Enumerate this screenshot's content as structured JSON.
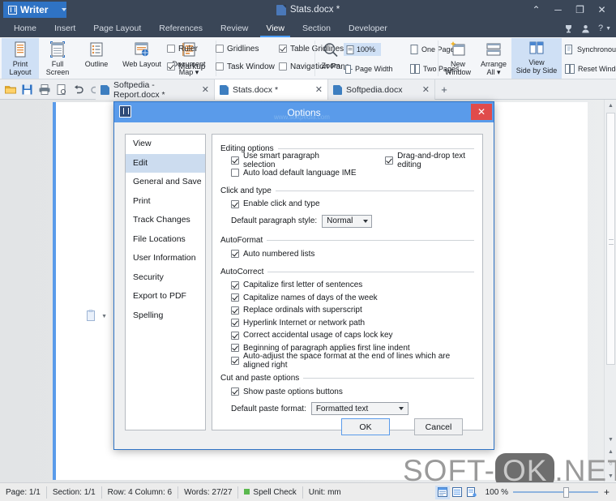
{
  "titlebar": {
    "app_name": "Writer",
    "document_title": "Stats.docx *",
    "controls": {
      "collapse": "⌃",
      "minimize": "─",
      "maximize": "❐",
      "close": "✕"
    }
  },
  "menu_tabs": [
    {
      "label": "Home",
      "active": false
    },
    {
      "label": "Insert",
      "active": false
    },
    {
      "label": "Page Layout",
      "active": false
    },
    {
      "label": "References",
      "active": false
    },
    {
      "label": "Review",
      "active": false
    },
    {
      "label": "View",
      "active": true
    },
    {
      "label": "Section",
      "active": false
    },
    {
      "label": "Developer",
      "active": false
    }
  ],
  "menu_right": {
    "trophy": "♀",
    "account": "὆4",
    "help": "?"
  },
  "ribbon": {
    "views": [
      {
        "label_top": "Print",
        "label_bottom": "Layout",
        "selected": true
      },
      {
        "label_top": "Full",
        "label_bottom": "Screen",
        "selected": false
      },
      {
        "label_top": "Outline",
        "label_bottom": "",
        "selected": false
      },
      {
        "label_top": "Web Layout",
        "label_bottom": "",
        "selected": false
      },
      {
        "label_top": "Document",
        "label_bottom": "Map ▾",
        "selected": false
      }
    ],
    "show_checkboxes": [
      {
        "label": "Ruler",
        "checked": false
      },
      {
        "label": "Gridlines",
        "checked": false
      },
      {
        "label": "Table Gridlines",
        "checked": true
      },
      {
        "label": "Markup",
        "checked": true
      },
      {
        "label": "Task Window",
        "checked": false
      },
      {
        "label": "Navigation Pane",
        "checked": false
      }
    ],
    "zoom_group": {
      "zoom_label": "Zoom",
      "percent": "100%",
      "page_width": "Page Width",
      "one_page": "One Page",
      "two_pages": "Two Pages"
    },
    "window_group": {
      "new_window_top": "New",
      "new_window_bottom": "Window",
      "arrange_top": "Arrange",
      "arrange_bottom": "All ▾",
      "side_by_side_top": "View",
      "side_by_side_bottom": "Side by Side",
      "synchronous_scroll": "Synchronous Scroll",
      "reset_window_pos": "Reset Window Pos"
    }
  },
  "doc_tabs": {
    "quick_icons": [
      "open-folder-icon",
      "save-icon",
      "print-icon",
      "print-preview-icon",
      "undo-icon",
      "redo-icon",
      "customize-caret-icon"
    ],
    "tabs": [
      {
        "label": "Softpedia - Report.docx *",
        "active": false
      },
      {
        "label": "Stats.docx *",
        "active": true
      },
      {
        "label": "Softpedia.docx",
        "active": false
      }
    ],
    "add_label": "+",
    "close_glyph": "✕"
  },
  "dialog": {
    "title": "Options",
    "title_watermark": "www.softpedia.com",
    "close_glyph": "✕",
    "nav_items": [
      {
        "label": "View",
        "selected": false
      },
      {
        "label": "Edit",
        "selected": true
      },
      {
        "label": "General and Save",
        "selected": false
      },
      {
        "label": "Print",
        "selected": false
      },
      {
        "label": "Track Changes",
        "selected": false
      },
      {
        "label": "File Locations",
        "selected": false
      },
      {
        "label": "User Information",
        "selected": false
      },
      {
        "label": "Security",
        "selected": false
      },
      {
        "label": "Export to PDF",
        "selected": false
      },
      {
        "label": "Spelling",
        "selected": false
      }
    ],
    "groups": {
      "editing_options": {
        "title": "Editing options",
        "use_smart_paragraph_selection": {
          "label": "Use smart paragraph selection",
          "checked": true
        },
        "drag_and_drop": {
          "label": "Drag-and-drop text editing",
          "checked": true
        },
        "auto_load_ime": {
          "label": "Auto load default language IME",
          "checked": false
        }
      },
      "click_and_type": {
        "title": "Click and type",
        "enable": {
          "label": "Enable click and type",
          "checked": true
        },
        "default_paragraph_style_label": "Default paragraph style:",
        "default_paragraph_style_value": "Normal"
      },
      "autoformat": {
        "title": "AutoFormat",
        "auto_numbered_lists": {
          "label": "Auto numbered lists",
          "checked": true
        }
      },
      "autocorrect": {
        "title": "AutoCorrect",
        "items": [
          {
            "label": "Capitalize first letter of sentences",
            "checked": true
          },
          {
            "label": "Capitalize names of days of the week",
            "checked": true
          },
          {
            "label": "Replace ordinals with superscript",
            "checked": true
          },
          {
            "label": "Hyperlink Internet or network path",
            "checked": true
          },
          {
            "label": "Correct accidental usage of caps lock key",
            "checked": true
          },
          {
            "label": "Beginning of paragraph applies first line indent",
            "checked": true
          },
          {
            "label": "Auto-adjust the space format at the end of lines which are aligned right",
            "checked": true
          }
        ]
      },
      "cut_and_paste": {
        "title": "Cut and paste options",
        "show_paste_buttons": {
          "label": "Show paste options buttons",
          "checked": true
        },
        "default_paste_format_label": "Default paste format:",
        "default_paste_format_value": "Formatted text"
      }
    },
    "ok_label": "OK",
    "cancel_label": "Cancel"
  },
  "statusbar": {
    "page": "Page: 1/1",
    "section": "Section: 1/1",
    "row_column": "Row: 4 Column: 6",
    "words": "Words: 27/27",
    "spell_check": "Spell Check",
    "unit": "Unit: mm",
    "zoom_percent": "100 %",
    "view_buttons": [
      "print-layout-view-icon",
      "outline-view-icon",
      "web-layout-view-icon"
    ],
    "zoom_out": "−",
    "zoom_in": "+"
  },
  "watermark": {
    "left": "SOFT-",
    "pill": "OK",
    "right": ".NET"
  },
  "colors": {
    "titlebar_bg": "#3a4657",
    "app_button": "#2f73c4",
    "accent_blue": "#5a9bea",
    "selection_blue": "#cfe0f5",
    "close_red": "#e04b4b",
    "spell_green": "#5ab84e"
  }
}
